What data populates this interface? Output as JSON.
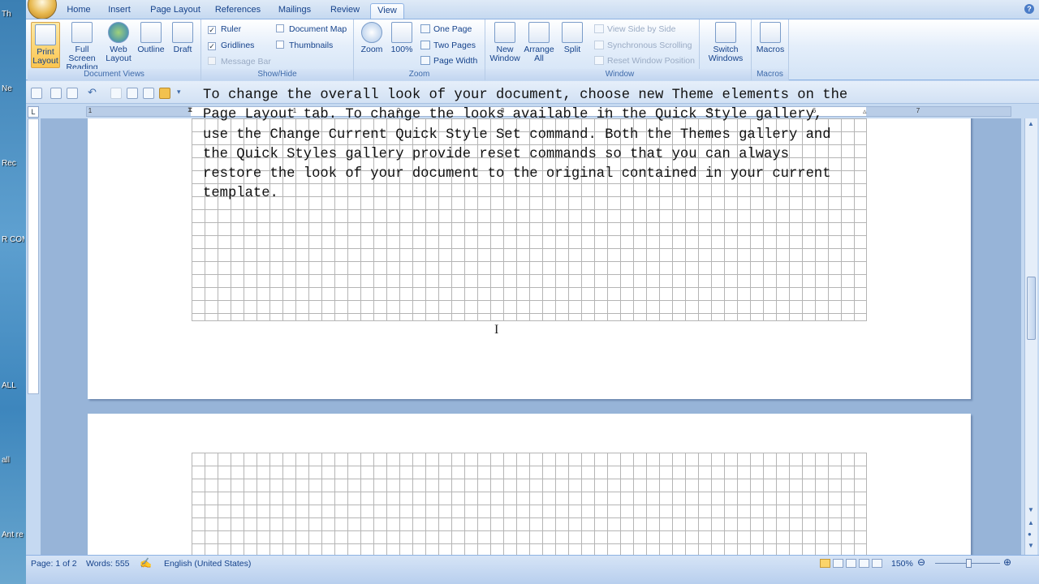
{
  "desktop": {
    "icons": [
      "Th",
      "Ne",
      "Rec",
      "R COM",
      "ALL",
      "all",
      "Ant re"
    ]
  },
  "tabs": [
    "Home",
    "Insert",
    "Page Layout",
    "References",
    "Mailings",
    "Review",
    "View"
  ],
  "active_tab": "View",
  "ribbon": {
    "document_views": {
      "label": "Document Views",
      "print_layout": "Print Layout",
      "full_screen_reading": "Full Screen Reading",
      "web_layout": "Web Layout",
      "outline": "Outline",
      "draft": "Draft"
    },
    "show_hide": {
      "label": "Show/Hide",
      "ruler": "Ruler",
      "gridlines": "Gridlines",
      "message_bar": "Message Bar",
      "document_map": "Document Map",
      "thumbnails": "Thumbnails"
    },
    "zoom": {
      "label": "Zoom",
      "zoom": "Zoom",
      "hundred": "100%",
      "one_page": "One Page",
      "two_pages": "Two Pages",
      "page_width": "Page Width"
    },
    "window": {
      "label": "Window",
      "new_window": "New Window",
      "arrange_all": "Arrange All",
      "split": "Split",
      "view_side_by_side": "View Side by Side",
      "synchronous_scrolling": "Synchronous Scrolling",
      "reset_window_position": "Reset Window Position",
      "switch_windows": "Switch Windows"
    },
    "macros": {
      "label": "Macros",
      "macros": "Macros"
    }
  },
  "ruler_numbers": [
    "1",
    "1",
    "2",
    "3",
    "4",
    "5",
    "6",
    "7"
  ],
  "document": {
    "text": "To change the overall look of your document, choose new Theme elements on the\nPage Layout tab. To change the looks available in the Quick Style gallery,\nuse the Change Current Quick Style Set command. Both the Themes gallery and\nthe Quick Styles gallery provide reset commands so that you can always\nrestore the look of your document to the original contained in your current\ntemplate."
  },
  "status": {
    "page": "Page: 1 of 2",
    "words": "Words: 555",
    "language": "English (United States)",
    "zoom": "150%"
  }
}
